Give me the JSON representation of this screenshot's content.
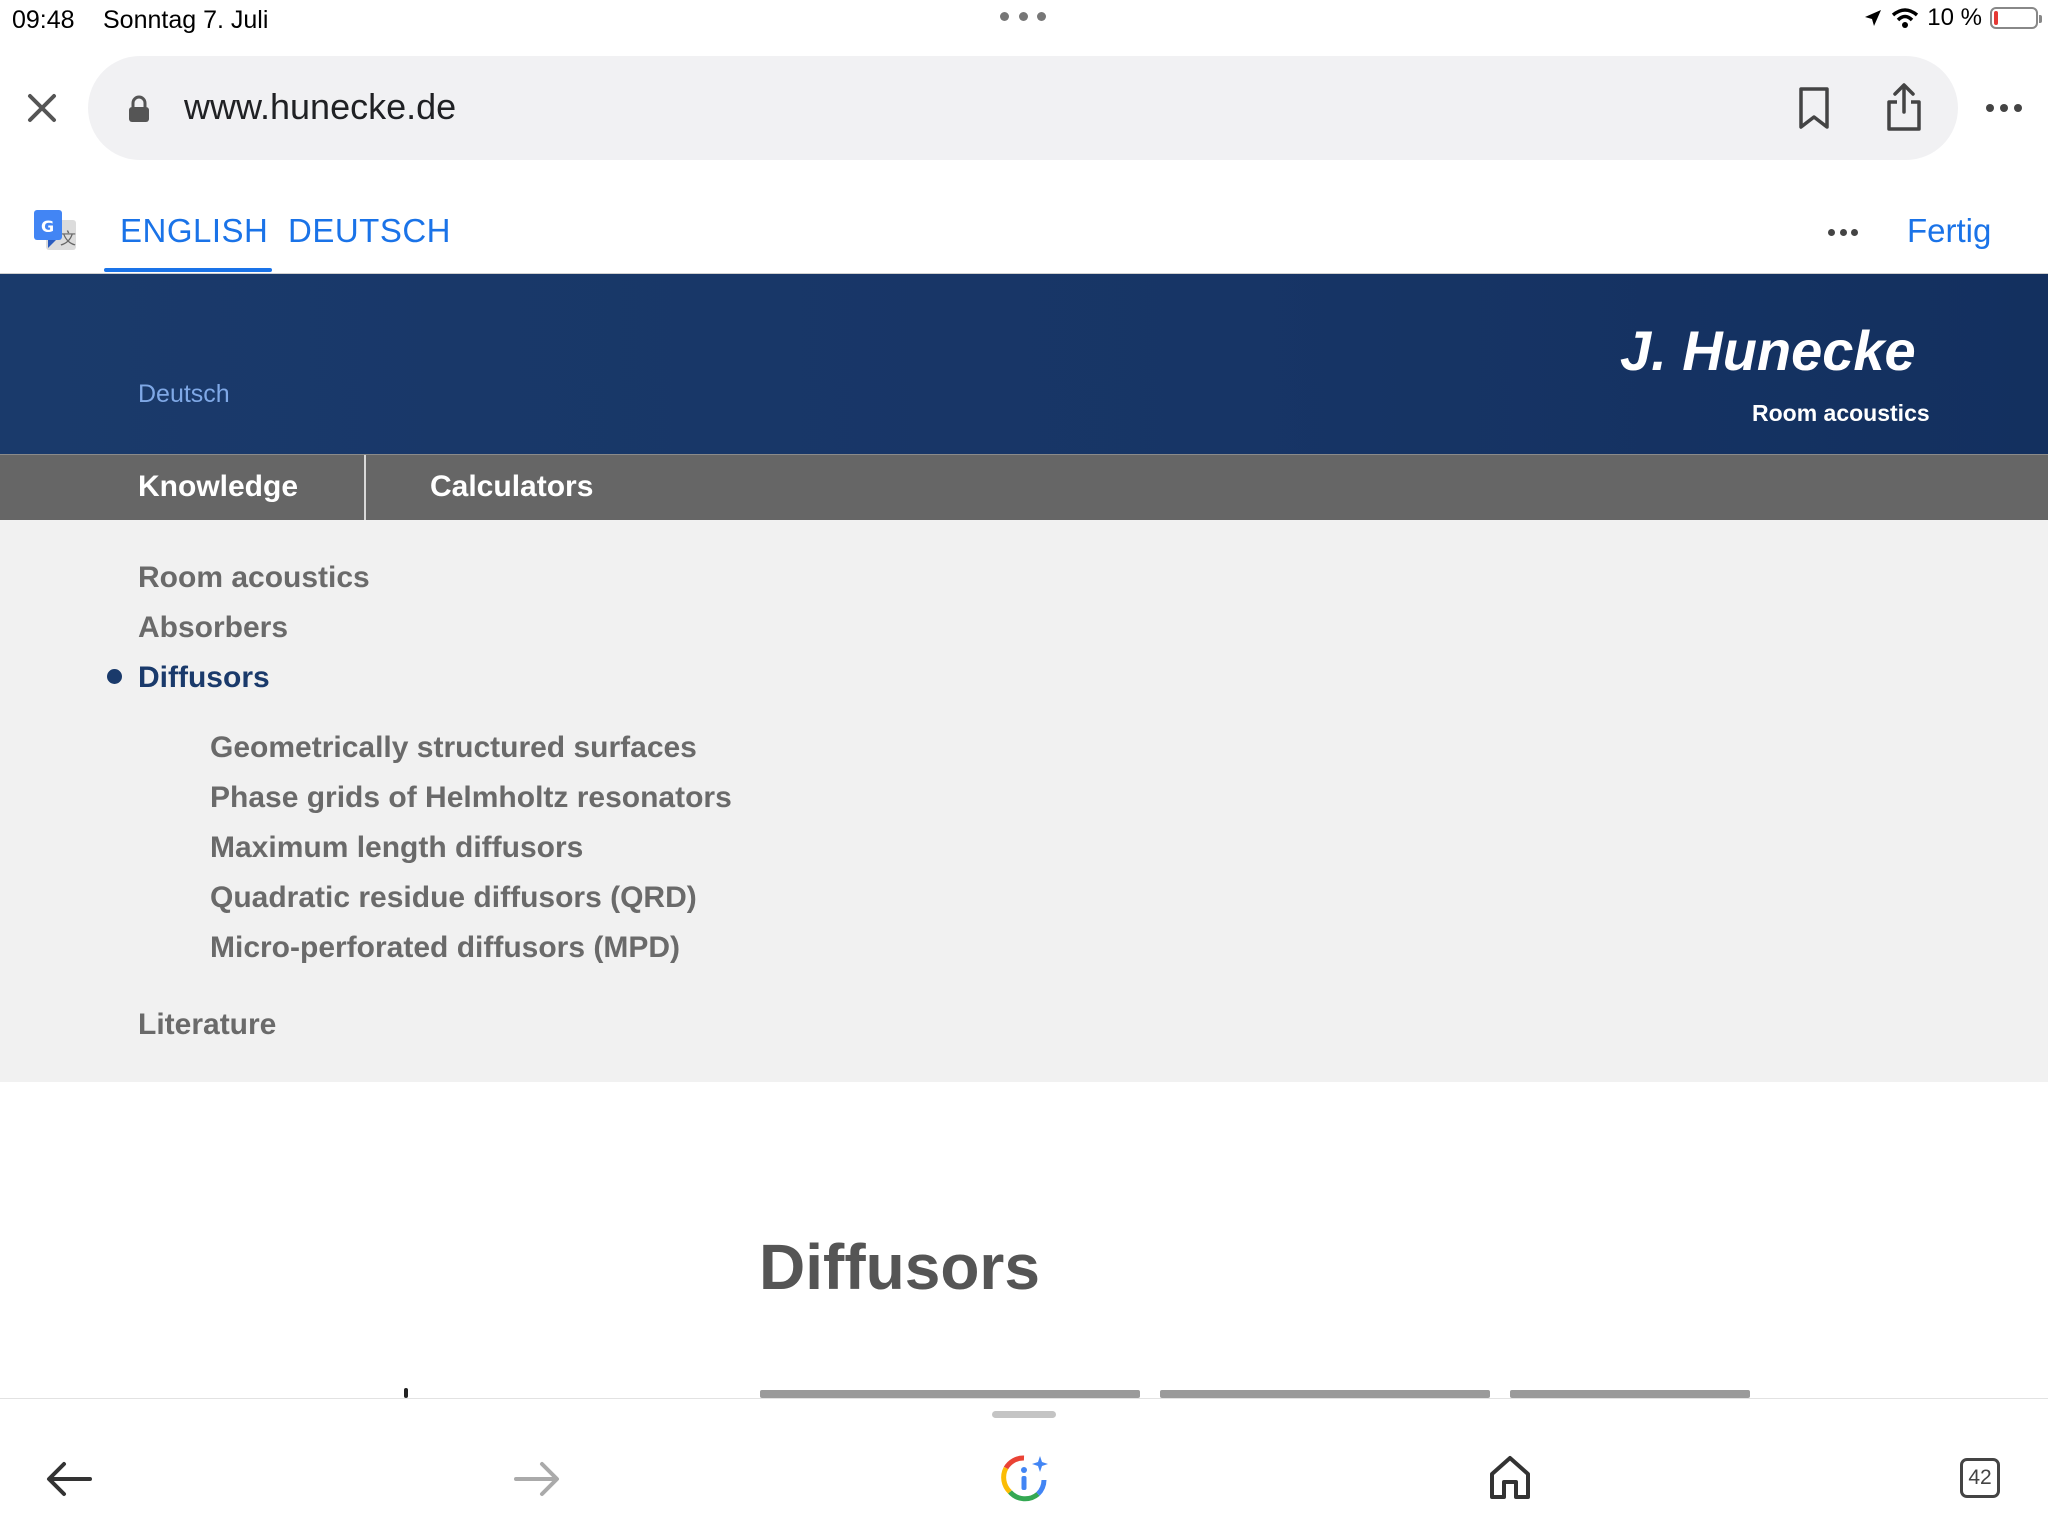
{
  "status_bar": {
    "time": "09:48",
    "date": "Sonntag 7. Juli",
    "battery": "10 %",
    "battery_level": 0.1
  },
  "browser": {
    "url": "www.hunecke.de",
    "icons": [
      "close-icon",
      "lock-icon",
      "bookmark-icon",
      "share-icon",
      "more-icon"
    ]
  },
  "translate_bar": {
    "tabs": [
      {
        "label": "ENGLISH",
        "active": true
      },
      {
        "label": "DEUTSCH",
        "active": false
      }
    ],
    "done_label": "Fertig",
    "accent_color": "#1a73e8"
  },
  "site": {
    "language_link": "Deutsch",
    "logo": "J. Hunecke",
    "subtitle": "Room acoustics",
    "header_color": "#1a3a6b",
    "nav": [
      "Knowledge",
      "Calculators"
    ],
    "subnav": {
      "items": [
        "Room acoustics",
        "Absorbers",
        "Diffusors"
      ],
      "active": "Diffusors",
      "children": [
        "Geometrically structured surfaces",
        "Phase grids of Helmholtz resonators",
        "Maximum length diffusors",
        "Quadratic residue diffusors (QRD)",
        "Micro-perforated diffusors (MPD)"
      ],
      "literature": "Literature"
    },
    "heading": "Diffusors"
  },
  "toolbar": {
    "tab_count": "42",
    "icons": [
      "back-arrow-icon",
      "forward-arrow-icon",
      "google-lens-icon",
      "home-icon",
      "tabs-icon"
    ]
  }
}
